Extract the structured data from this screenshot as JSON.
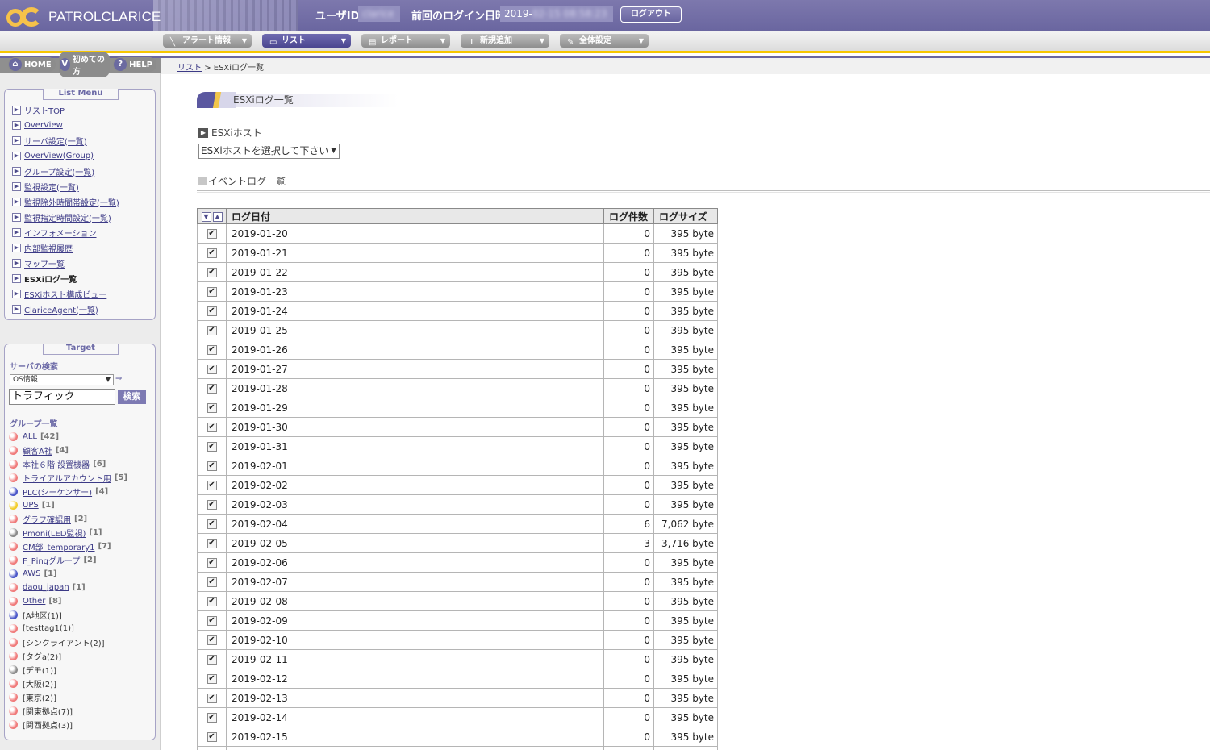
{
  "header": {
    "logo_text": "PATROLCLARICE",
    "user_id_label": "ユーザID",
    "user_id_value": "clarice",
    "last_login_label": "前回のログイン日時",
    "last_login_prefix": "2019-",
    "last_login_hidden": "02-15 08:58:23",
    "logout_label": "ログアウト"
  },
  "nav": [
    {
      "label": "アラート情報",
      "icon": "alert-icon"
    },
    {
      "label": "リスト",
      "icon": "list-icon"
    },
    {
      "label": "レポート",
      "icon": "report-icon"
    },
    {
      "label": "新規追加",
      "icon": "add-icon"
    },
    {
      "label": "全体設定",
      "icon": "settings-icon"
    }
  ],
  "quicklinks": {
    "home": "HOME",
    "first": "初めての方",
    "help": "HELP"
  },
  "breadcrumb": {
    "link": "リスト",
    "sep": ">",
    "current": "ESXiログ一覧"
  },
  "listmenu": {
    "title": "List Menu",
    "items": [
      "リストTOP",
      "OverView",
      "サーバ設定(一覧)",
      "OverView(Group)",
      "グループ設定(一覧)",
      "監視設定(一覧)",
      "監視除外時間帯設定(一覧)",
      "監視指定時間設定(一覧)",
      "インフォメーション",
      "内部監視履歴",
      "マップ一覧",
      "ESXiログ一覧",
      "ESXiホスト構成ビュー",
      "ClariceAgent(一覧)"
    ],
    "current_index": 11
  },
  "target": {
    "title": "Target",
    "server_search_label": "サーバの検索",
    "search_type": "OS情報",
    "search_value": "トラフィック",
    "search_button": "検索",
    "group_list_label": "グループ一覧",
    "groups": [
      {
        "name": "ALL",
        "count": "[42]",
        "color": "#f07a7a"
      },
      {
        "name": "顧客A社",
        "count": "[4]",
        "color": "#f07a7a"
      },
      {
        "name": "本社６階 設置機器",
        "count": "[6]",
        "color": "#f07a7a"
      },
      {
        "name": "トライアルアカウント用",
        "count": "[5]",
        "color": "#f07a7a"
      },
      {
        "name": "PLC(シーケンサー)",
        "count": "[4]",
        "color": "#4a56c8"
      },
      {
        "name": "UPS",
        "count": "[1]",
        "color": "#f2cc2a"
      },
      {
        "name": "グラフ確認用",
        "count": "[2]",
        "color": "#f07a7a"
      },
      {
        "name": "Pmoni(LED監視)",
        "count": "[1]",
        "color": "#8a8a8a"
      },
      {
        "name": "CM部_temporary1",
        "count": "[7]",
        "color": "#f07a7a"
      },
      {
        "name": "F_Pingグループ",
        "count": "[2]",
        "color": "#f07a7a"
      },
      {
        "name": "AWS",
        "count": "[1]",
        "color": "#4a56c8"
      },
      {
        "name": "daou_japan",
        "count": "[1]",
        "color": "#f07a7a"
      },
      {
        "name": "Other",
        "count": "[8]",
        "color": "#f07a7a"
      }
    ],
    "tags": [
      {
        "name": "[A地区(1)]",
        "color": "#4a56c8"
      },
      {
        "name": "[testtag1(1)]",
        "color": "#f07a7a"
      },
      {
        "name": "[シンクライアント(2)]",
        "color": "#f07a7a"
      },
      {
        "name": "[タグa(2)]",
        "color": "#f07a7a"
      },
      {
        "name": "[デモ(1)]",
        "color": "#8a8a8a"
      },
      {
        "name": "[大阪(2)]",
        "color": "#f07a7a"
      },
      {
        "name": "[東京(2)]",
        "color": "#f07a7a"
      },
      {
        "name": "[関東拠点(7)]",
        "color": "#f07a7a"
      },
      {
        "name": "[関西拠点(3)]",
        "color": "#f07a7a"
      }
    ]
  },
  "main": {
    "page_title": "ESXiログ一覧",
    "host_label": "ESXiホスト",
    "host_select_value": "ESXiホストを選択して下さい",
    "event_log_label": "イベントログ一覧",
    "table": {
      "columns": [
        "ログ日付",
        "ログ件数",
        "ログサイズ"
      ],
      "rows": [
        [
          "2019-01-20",
          "0",
          "395 byte"
        ],
        [
          "2019-01-21",
          "0",
          "395 byte"
        ],
        [
          "2019-01-22",
          "0",
          "395 byte"
        ],
        [
          "2019-01-23",
          "0",
          "395 byte"
        ],
        [
          "2019-01-24",
          "0",
          "395 byte"
        ],
        [
          "2019-01-25",
          "0",
          "395 byte"
        ],
        [
          "2019-01-26",
          "0",
          "395 byte"
        ],
        [
          "2019-01-27",
          "0",
          "395 byte"
        ],
        [
          "2019-01-28",
          "0",
          "395 byte"
        ],
        [
          "2019-01-29",
          "0",
          "395 byte"
        ],
        [
          "2019-01-30",
          "0",
          "395 byte"
        ],
        [
          "2019-01-31",
          "0",
          "395 byte"
        ],
        [
          "2019-02-01",
          "0",
          "395 byte"
        ],
        [
          "2019-02-02",
          "0",
          "395 byte"
        ],
        [
          "2019-02-03",
          "0",
          "395 byte"
        ],
        [
          "2019-02-04",
          "6",
          "7,062 byte"
        ],
        [
          "2019-02-05",
          "3",
          "3,716 byte"
        ],
        [
          "2019-02-06",
          "0",
          "395 byte"
        ],
        [
          "2019-02-07",
          "0",
          "395 byte"
        ],
        [
          "2019-02-08",
          "0",
          "395 byte"
        ],
        [
          "2019-02-09",
          "0",
          "395 byte"
        ],
        [
          "2019-02-10",
          "0",
          "395 byte"
        ],
        [
          "2019-02-11",
          "0",
          "395 byte"
        ],
        [
          "2019-02-12",
          "0",
          "395 byte"
        ],
        [
          "2019-02-13",
          "0",
          "395 byte"
        ],
        [
          "2019-02-14",
          "0",
          "395 byte"
        ],
        [
          "2019-02-15",
          "0",
          "395 byte"
        ],
        [
          "",
          "",
          ""
        ]
      ]
    }
  }
}
